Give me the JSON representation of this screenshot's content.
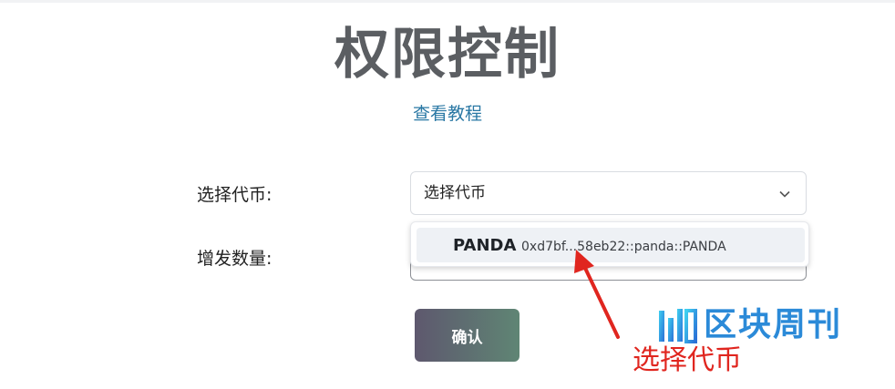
{
  "page": {
    "title": "权限控制",
    "tutorial_link": "查看教程"
  },
  "form": {
    "token_label": "选择代币:",
    "token_select_value": "选择代币",
    "amount_label": "增发数量:",
    "confirm_label": "确认"
  },
  "dropdown": {
    "options": [
      {
        "name": "PANDA",
        "address": "0xd7bf...58eb22::panda::PANDA"
      }
    ]
  },
  "annotation": {
    "text": "选择代币",
    "color": "#e0261f"
  },
  "watermark": {
    "text": "区块周刊",
    "color": "#2b8ad8"
  },
  "colors": {
    "title": "#5b5e62",
    "link": "#2a78a4",
    "button_gradient_start": "#5e586e",
    "button_gradient_end": "#5f8574",
    "option_highlight": "#eef1f5"
  },
  "icons": {
    "select_chevron": "chevron-down-icon",
    "annotation_arrow": "red-arrow-icon",
    "watermark_logo": "blockweekly-logo-icon"
  }
}
